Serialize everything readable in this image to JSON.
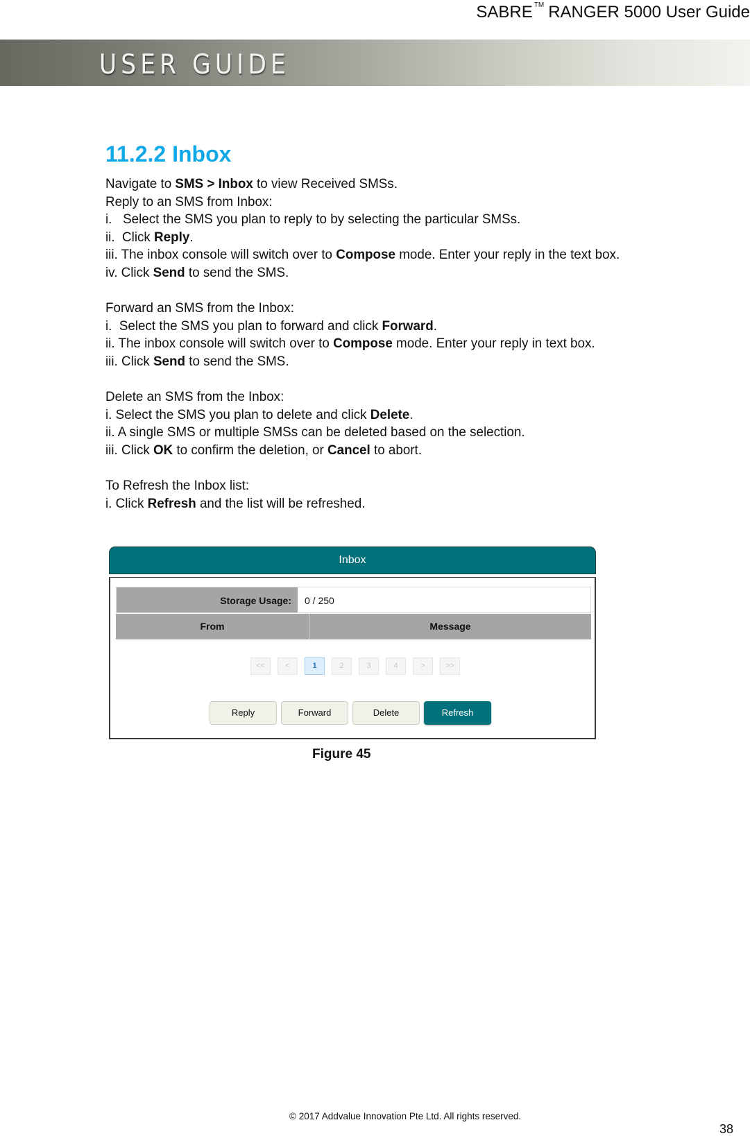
{
  "header": {
    "product_prefix": "SABRE",
    "trademark": "TM",
    "product_suffix": "RANGER 5000 User Guide",
    "banner_text": "USER GUIDE"
  },
  "section": {
    "heading": "11.2.2 Inbox"
  },
  "body": {
    "intro": {
      "pre": "Navigate to ",
      "bold": "SMS > Inbox",
      "post": " to view Received SMSs."
    },
    "reply": {
      "title": "Reply to an SMS from Inbox:",
      "step1": "i.   Select the SMS you plan to reply to by selecting the particular SMSs.",
      "step2": {
        "pre": "ii.  Click ",
        "bold": "Reply",
        "post": "."
      },
      "step3": {
        "pre": "iii. The inbox console will switch over to ",
        "bold": "Compose",
        "post": " mode. Enter your reply in the text box."
      },
      "step4": {
        "pre": "iv. Click ",
        "bold": "Send",
        "post": " to send the SMS."
      }
    },
    "forward": {
      "title": "Forward an SMS from the Inbox:",
      "step1": {
        "pre": "i.  Select the SMS you plan to forward and click ",
        "bold": "Forward",
        "post": "."
      },
      "step2": {
        "pre": "ii. The inbox console will switch over to ",
        "bold": "Compose",
        "post": " mode. Enter your reply in text box."
      },
      "step3": {
        "pre": "iii. Click ",
        "bold": "Send",
        "post": " to send the SMS."
      }
    },
    "delete": {
      "title": "Delete an SMS from the Inbox:",
      "step1": {
        "pre": "i. Select the SMS you plan to delete and click ",
        "bold": "Delete",
        "post": "."
      },
      "step2": "ii. A single SMS or multiple SMSs can be deleted based on the selection.",
      "step3": {
        "pre": "iii. Click ",
        "bold": "OK",
        "mid": " to confirm the deletion, or ",
        "bold2": "Cancel",
        "post": " to abort."
      }
    },
    "refresh": {
      "title": "To Refresh the Inbox list:",
      "step1": {
        "pre": "i. Click ",
        "bold": "Refresh",
        "post": " and the list will be refreshed."
      }
    }
  },
  "figure": {
    "panel_title": "Inbox",
    "storage_label": "Storage Usage:",
    "storage_value": "0 / 250",
    "columns": [
      "From",
      "Message"
    ],
    "pagination": {
      "buttons": [
        "<<",
        "<",
        "1",
        "2",
        "3",
        "4",
        ">",
        ">>"
      ],
      "current_page": "1"
    },
    "actions": {
      "reply": "Reply",
      "forward": "Forward",
      "delete": "Delete",
      "refresh": "Refresh"
    },
    "caption": "Figure 45",
    "accent_color": "#03717c"
  },
  "footer": {
    "copyright": "© 2017 Addvalue Innovation Pte Ltd. All rights reserved.",
    "page_number": "38"
  }
}
